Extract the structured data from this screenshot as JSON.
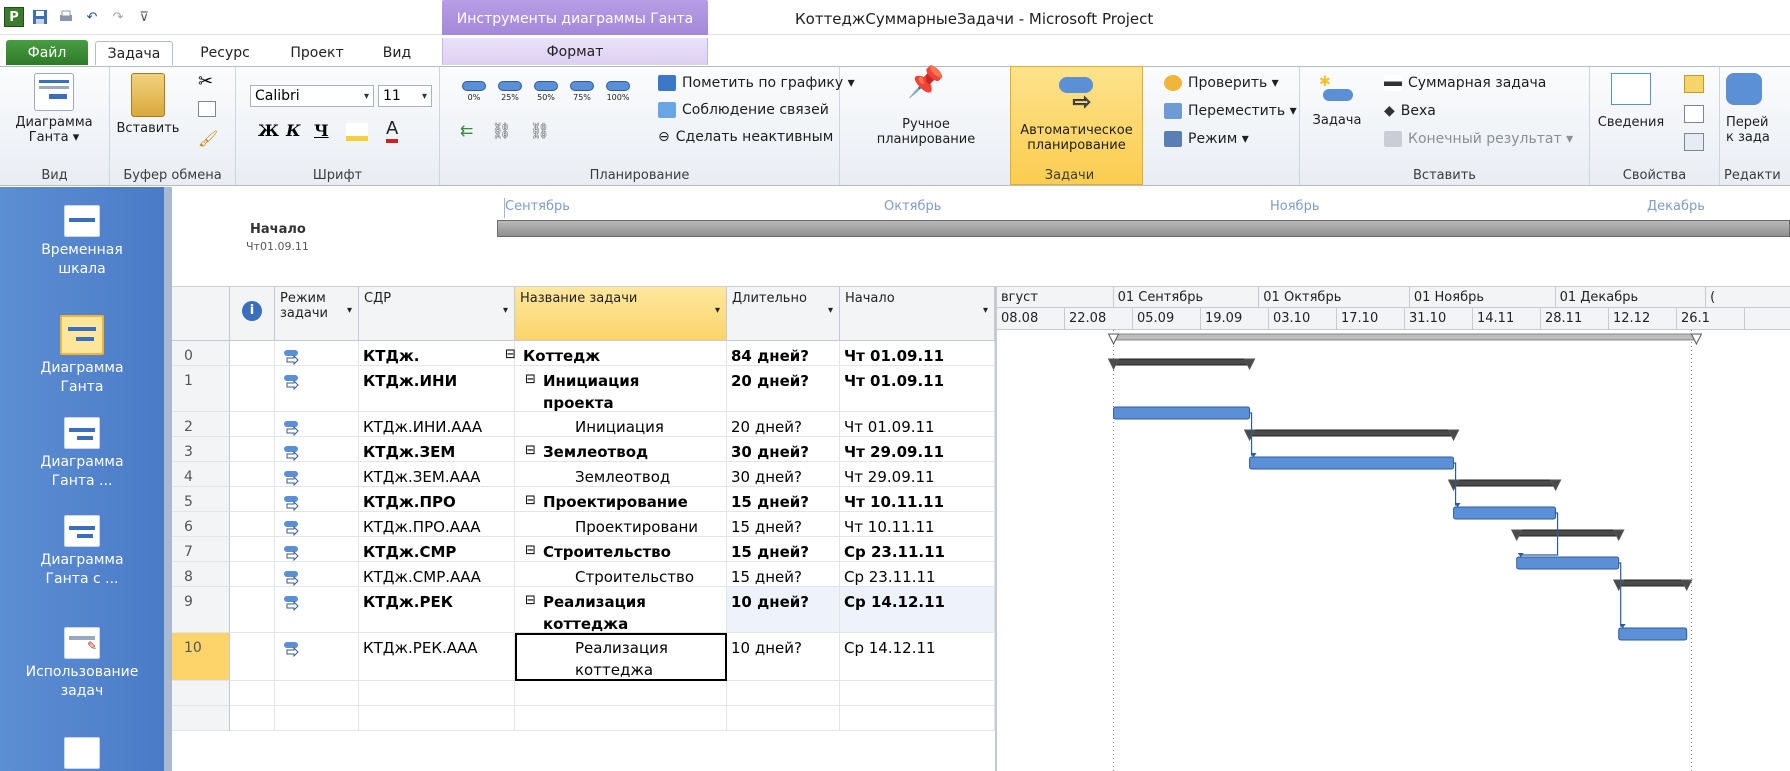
{
  "window": {
    "app_title": "КоттеджСуммарныеЗадачи  -  Microsoft Project",
    "context_title": "Инструменты диаграммы Ганта"
  },
  "tabs": {
    "file": "Файл",
    "task": "Задача",
    "resource": "Ресурс",
    "project": "Проект",
    "view": "Вид",
    "format": "Формат"
  },
  "ribbon": {
    "view_group": {
      "button": "Диаграмма\nГанта ▾",
      "label": "Вид"
    },
    "clipboard": {
      "paste": "Вставить",
      "label": "Буфер обмена"
    },
    "font": {
      "name": "Calibri",
      "size": "11",
      "bold": "Ж",
      "italic": "К",
      "underline": "Ч",
      "label": "Шрифт"
    },
    "schedule": {
      "percents": [
        "0%",
        "25%",
        "50%",
        "75%",
        "100%"
      ],
      "mark_on_track": "Пометить по графику ▾",
      "respect_links": "Соблюдение связей",
      "inactivate": "Сделать неактивным",
      "label": "Планирование"
    },
    "tasks": {
      "manual": "Ручное\nпланирование",
      "auto": "Автоматическое\nпланирование",
      "inspect": "Проверить ▾",
      "move": "Переместить ▾",
      "mode": "Режим ▾",
      "label": "Задачи"
    },
    "insert": {
      "task": "Задача",
      "summary": "Суммарная задача",
      "milestone": "Веха",
      "deliverable": "Конечный результат ▾",
      "label": "Вставить"
    },
    "properties": {
      "info": "Сведения",
      "label": "Свойства"
    },
    "editing": {
      "goto": "Перей\nк зада",
      "label": "Редакти"
    }
  },
  "viewbar": {
    "items": [
      {
        "label": "Временная\nшкала"
      },
      {
        "label": "Диаграмма\nГанта"
      },
      {
        "label": "Диаграмма\nГанта    ..."
      },
      {
        "label": "Диаграмма\nГанта с    ..."
      },
      {
        "label": "Использование\nзадач"
      }
    ]
  },
  "timeline": {
    "months": [
      "Сентябрь",
      "Октябрь",
      "Ноябрь",
      "Декабрь"
    ],
    "start_label": "Начало",
    "start_date": "Чт01.09.11"
  },
  "grid": {
    "headers": {
      "mode": "Режим\nзадачи",
      "wbs": "СДР",
      "name": "Название задачи",
      "duration": "Длительно",
      "start": "Начало"
    },
    "rows": [
      {
        "id": "0",
        "wbs": "КТДж.",
        "name": "Коттедж",
        "duration": "84 дней?",
        "start": "Чт 01.09.11",
        "summary": true
      },
      {
        "id": "1",
        "wbs": "КТДж.ИНИ",
        "name": "Инициация\nпроекта",
        "duration": "20 дней?",
        "start": "Чт 01.09.11",
        "summary": true
      },
      {
        "id": "2",
        "wbs": "КТДж.ИНИ.ААА",
        "name": "Инициация",
        "duration": "20 дней?",
        "start": "Чт 01.09.11",
        "summary": false
      },
      {
        "id": "3",
        "wbs": "КТДж.ЗЕМ",
        "name": "Землеотвод",
        "duration": "30 дней?",
        "start": "Чт 29.09.11",
        "summary": true
      },
      {
        "id": "4",
        "wbs": "КТДж.ЗЕМ.ААА",
        "name": "Землеотвод",
        "duration": "30 дней?",
        "start": "Чт 29.09.11",
        "summary": false
      },
      {
        "id": "5",
        "wbs": "КТДж.ПРО",
        "name": "Проектирование",
        "duration": "15 дней?",
        "start": "Чт 10.11.11",
        "summary": true
      },
      {
        "id": "6",
        "wbs": "КТДж.ПРО.ААА",
        "name": "Проектировани",
        "duration": "15 дней?",
        "start": "Чт 10.11.11",
        "summary": false
      },
      {
        "id": "7",
        "wbs": "КТДж.СМР",
        "name": "Строительство",
        "duration": "15 дней?",
        "start": "Ср 23.11.11",
        "summary": true
      },
      {
        "id": "8",
        "wbs": "КТДж.СМР.ААА",
        "name": "Строительство",
        "duration": "15 дней?",
        "start": "Ср 23.11.11",
        "summary": false
      },
      {
        "id": "9",
        "wbs": "КТДж.РЕК",
        "name": "Реализация\nкоттеджа",
        "duration": "10 дней?",
        "start": "Ср 14.12.11",
        "summary": true
      },
      {
        "id": "10",
        "wbs": "КТДж.РЕК.ААА",
        "name": "Реализация\nкоттеджа",
        "duration": "10 дней?",
        "start": "Ср 14.12.11",
        "summary": false
      }
    ]
  },
  "gantt": {
    "months": [
      "вгуст",
      "01 Сентябрь",
      "01 Октябрь",
      "01 Ноябрь",
      "01 Декабрь",
      "("
    ],
    "weeks": [
      "08.08",
      "22.08",
      "05.09",
      "19.09",
      "03.10",
      "17.10",
      "31.10",
      "14.11",
      "28.11",
      "12.12",
      "26.1"
    ],
    "tasks": [
      {
        "row": "0",
        "start": "01.09.11",
        "end": "29.12.11",
        "type": "project-summary"
      },
      {
        "row": "1",
        "start": "01.09.11",
        "end": "28.09.11",
        "type": "summary"
      },
      {
        "row": "2",
        "start": "01.09.11",
        "end": "28.09.11",
        "type": "task"
      },
      {
        "row": "3",
        "start": "29.09.11",
        "end": "09.11.11",
        "type": "summary"
      },
      {
        "row": "4",
        "start": "29.09.11",
        "end": "09.11.11",
        "type": "task"
      },
      {
        "row": "5",
        "start": "10.11.11",
        "end": "30.11.11",
        "type": "summary"
      },
      {
        "row": "6",
        "start": "10.11.11",
        "end": "30.11.11",
        "type": "task"
      },
      {
        "row": "7",
        "start": "23.11.11",
        "end": "13.12.11",
        "type": "summary"
      },
      {
        "row": "8",
        "start": "23.11.11",
        "end": "13.12.11",
        "type": "task"
      },
      {
        "row": "9",
        "start": "14.12.11",
        "end": "27.12.11",
        "type": "summary"
      },
      {
        "row": "10",
        "start": "14.12.11",
        "end": "27.12.11",
        "type": "task"
      }
    ]
  }
}
